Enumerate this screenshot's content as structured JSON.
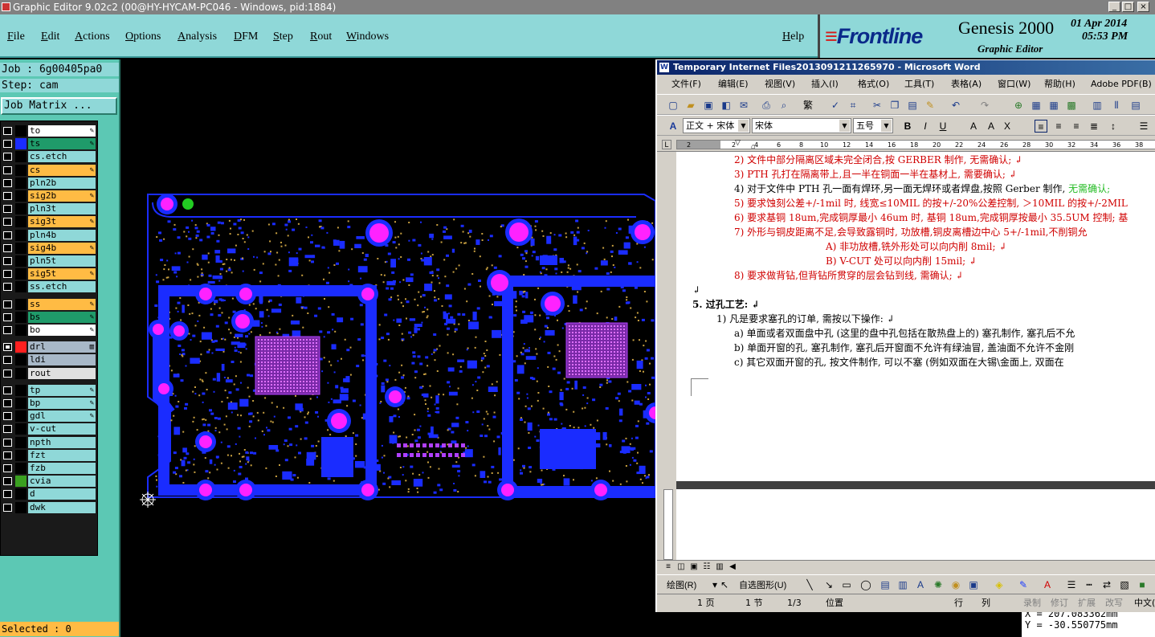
{
  "genesis": {
    "window_title": "Graphic Editor 9.02c2 (00@HY-HYCAM-PC046 - Windows, pid:1884)",
    "menu": [
      "File",
      "Edit",
      "Actions",
      "Options",
      "Analysis",
      "DFM",
      "Step",
      "Rout",
      "Windows"
    ],
    "help": "Help",
    "logo": {
      "brand": "Frontline",
      "product": "Genesis 2000",
      "date": "01 Apr 2014",
      "time": "05:53 PM",
      "subtitle": "Graphic Editor"
    },
    "job": "Job : 6g00405pa0",
    "step": "Step: cam",
    "job_matrix": "Job Matrix ...",
    "selected": "Selected : 0",
    "coords": {
      "x": "X = 207.083362mm",
      "y": "Y = -30.550775mm"
    }
  },
  "layers": [
    {
      "name": "to",
      "bg": "#ffffff",
      "swatch": "#000000",
      "mark": "✎"
    },
    {
      "name": "ts",
      "bg": "#1f9b6a",
      "swatch": "#1a2cff",
      "mark": "✎"
    },
    {
      "name": "cs.etch",
      "bg": "#8fd8d8",
      "swatch": "#000000",
      "mark": ""
    },
    {
      "name": "cs",
      "bg": "#ffbb44",
      "swatch": "#000000",
      "mark": "✎"
    },
    {
      "name": "pln2b",
      "bg": "#8fd8d8",
      "swatch": "#000000",
      "mark": ""
    },
    {
      "name": "sig2b",
      "bg": "#ffbb44",
      "swatch": "#000000",
      "mark": "✎"
    },
    {
      "name": "pln3t",
      "bg": "#8fd8d8",
      "swatch": "#000000",
      "mark": ""
    },
    {
      "name": "sig3t",
      "bg": "#ffbb44",
      "swatch": "#000000",
      "mark": "✎"
    },
    {
      "name": "pln4b",
      "bg": "#8fd8d8",
      "swatch": "#000000",
      "mark": ""
    },
    {
      "name": "sig4b",
      "bg": "#ffbb44",
      "swatch": "#000000",
      "mark": "✎"
    },
    {
      "name": "pln5t",
      "bg": "#8fd8d8",
      "swatch": "#000000",
      "mark": ""
    },
    {
      "name": "sig5t",
      "bg": "#ffbb44",
      "swatch": "#000000",
      "mark": "✎"
    },
    {
      "name": "ss.etch",
      "bg": "#8fd8d8",
      "swatch": "#000000",
      "mark": ""
    },
    {
      "name": "ss",
      "bg": "#ffbb44",
      "swatch": "#000000",
      "mark": "✎"
    },
    {
      "name": "bs",
      "bg": "#1f9b6a",
      "swatch": "#000000",
      "mark": "✎"
    },
    {
      "name": "bo",
      "bg": "#ffffff",
      "swatch": "#000000",
      "mark": "✎"
    },
    {
      "name": "drl",
      "bg": "#a8b8c8",
      "swatch": "#ff2020",
      "mark": "▥",
      "selected": true
    },
    {
      "name": "ldi",
      "bg": "#a8b8c8",
      "swatch": "#000000",
      "mark": ""
    },
    {
      "name": "rout",
      "bg": "#e0e0e0",
      "swatch": "#000000",
      "mark": ""
    },
    {
      "name": "tp",
      "bg": "#8fd8d8",
      "swatch": "#000000",
      "mark": "✎"
    },
    {
      "name": "bp",
      "bg": "#8fd8d8",
      "swatch": "#000000",
      "mark": "✎"
    },
    {
      "name": "gdl",
      "bg": "#8fd8d8",
      "swatch": "#000000",
      "mark": "✎"
    },
    {
      "name": "v-cut",
      "bg": "#8fd8d8",
      "swatch": "#000000",
      "mark": ""
    },
    {
      "name": "npth",
      "bg": "#8fd8d8",
      "swatch": "#000000",
      "mark": ""
    },
    {
      "name": "fzt",
      "bg": "#8fd8d8",
      "swatch": "#000000",
      "mark": ""
    },
    {
      "name": "fzb",
      "bg": "#8fd8d8",
      "swatch": "#000000",
      "mark": ""
    },
    {
      "name": "cvia",
      "bg": "#8fd8d8",
      "swatch": "#3aa020",
      "mark": ""
    },
    {
      "name": "d",
      "bg": "#8fd8d8",
      "swatch": "#000000",
      "mark": ""
    },
    {
      "name": "dwk",
      "bg": "#8fd8d8",
      "swatch": "#000000",
      "mark": ""
    }
  ],
  "word": {
    "title": "Temporary Internet Files2013091211265970 - Microsoft Word",
    "menu": [
      "文件(F)",
      "编辑(E)",
      "视图(V)",
      "插入(I)",
      "格式(O)",
      "工具(T)",
      "表格(A)",
      "窗口(W)",
      "帮助(H)",
      "Adobe PDF(B)"
    ],
    "style_box": "正文 + 宋体",
    "font_box": "宋体",
    "size_box": "五号",
    "ruler_ticks": [
      "2",
      "2",
      "4",
      "6",
      "8",
      "10",
      "12",
      "14",
      "16",
      "18",
      "20",
      "22",
      "24",
      "26",
      "28",
      "30",
      "32",
      "34",
      "36",
      "38"
    ],
    "lines": [
      {
        "segs": [
          {
            "t": "2)  文件中部分隔离区域未完全闭合,按 GERBER 制作, 无需确认; ↲",
            "c": "red"
          }
        ]
      },
      {
        "segs": [
          {
            "t": "3)  PTH 孔打在隔离带上,且一半在铜面一半在基材上, 需要确认; ↲",
            "c": "red"
          }
        ]
      },
      {
        "segs": [
          {
            "t": "4)  对于文件中 PTH 孔一面有焊环,另一面无焊环或者焊盘,按照 Gerber 制作, ",
            "c": "blk"
          },
          {
            "t": "无需确认;",
            "c": "grn"
          }
        ]
      },
      {
        "segs": [
          {
            "t": "5)  要求蚀刻公差+/-1mil 时, 线宽≤10MIL 的按+/-20%公差控制, ＞10MIL 的按+/-2MIL",
            "c": "red"
          }
        ]
      },
      {
        "segs": [
          {
            "t": "6)  要求基铜 18um,完成铜厚最小 46um 时, 基铜 18um,完成铜厚按最小 35.5UM 控制; 基",
            "c": "red"
          }
        ]
      },
      {
        "segs": [
          {
            "t": "7)  外形与铜皮距离不足,会导致露铜时, 功放槽,铜皮离槽边中心 5+/-1mil,不削铜允",
            "c": "red"
          }
        ]
      },
      {
        "segs": [
          {
            "t": "A)  非功放槽,铣外形处可以向内削 8mil; ↲",
            "c": "red"
          }
        ]
      },
      {
        "segs": [
          {
            "t": "B)  V-CUT 处可以向内削 15mil; ↲",
            "c": "red"
          }
        ]
      },
      {
        "segs": [
          {
            "t": "8)  要求做背钻,但背钻所贯穿的层会钻到线, 需确认; ↲",
            "c": "red"
          }
        ]
      },
      {
        "segs": [
          {
            "t": "↲",
            "c": "blk"
          }
        ]
      },
      {
        "segs": [
          {
            "t": "5.  过孔工艺: ↲",
            "c": "blk"
          }
        ]
      },
      {
        "segs": [
          {
            "t": "1)  凡是要求塞孔的订单, 需按以下操作: ↲",
            "c": "blk"
          }
        ]
      },
      {
        "segs": [
          {
            "t": "a)  单面或者双面盘中孔 (这里的盘中孔包括在散热盘上的) 塞孔制作, 塞孔后不允",
            "c": "blk"
          }
        ]
      },
      {
        "segs": [
          {
            "t": "b)  单面开窗的孔, 塞孔制作, 塞孔后开窗面不允许有绿油冒, 盖油面不允许不金刚",
            "c": "blk"
          }
        ]
      },
      {
        "segs": [
          {
            "t": "c)  其它双面开窗的孔, 按文件制作, 可以不塞 (例如双面在大锡\\金面上, 双面在",
            "c": "blk"
          }
        ]
      }
    ],
    "draw_label": "绘图(R)",
    "autoshape_label": "自选图形(U)",
    "status": [
      "1 页",
      "1 节",
      "1/3",
      "位置",
      "行",
      "列",
      "录制",
      "修订",
      "扩展",
      "改写",
      "中文(中国)"
    ]
  }
}
